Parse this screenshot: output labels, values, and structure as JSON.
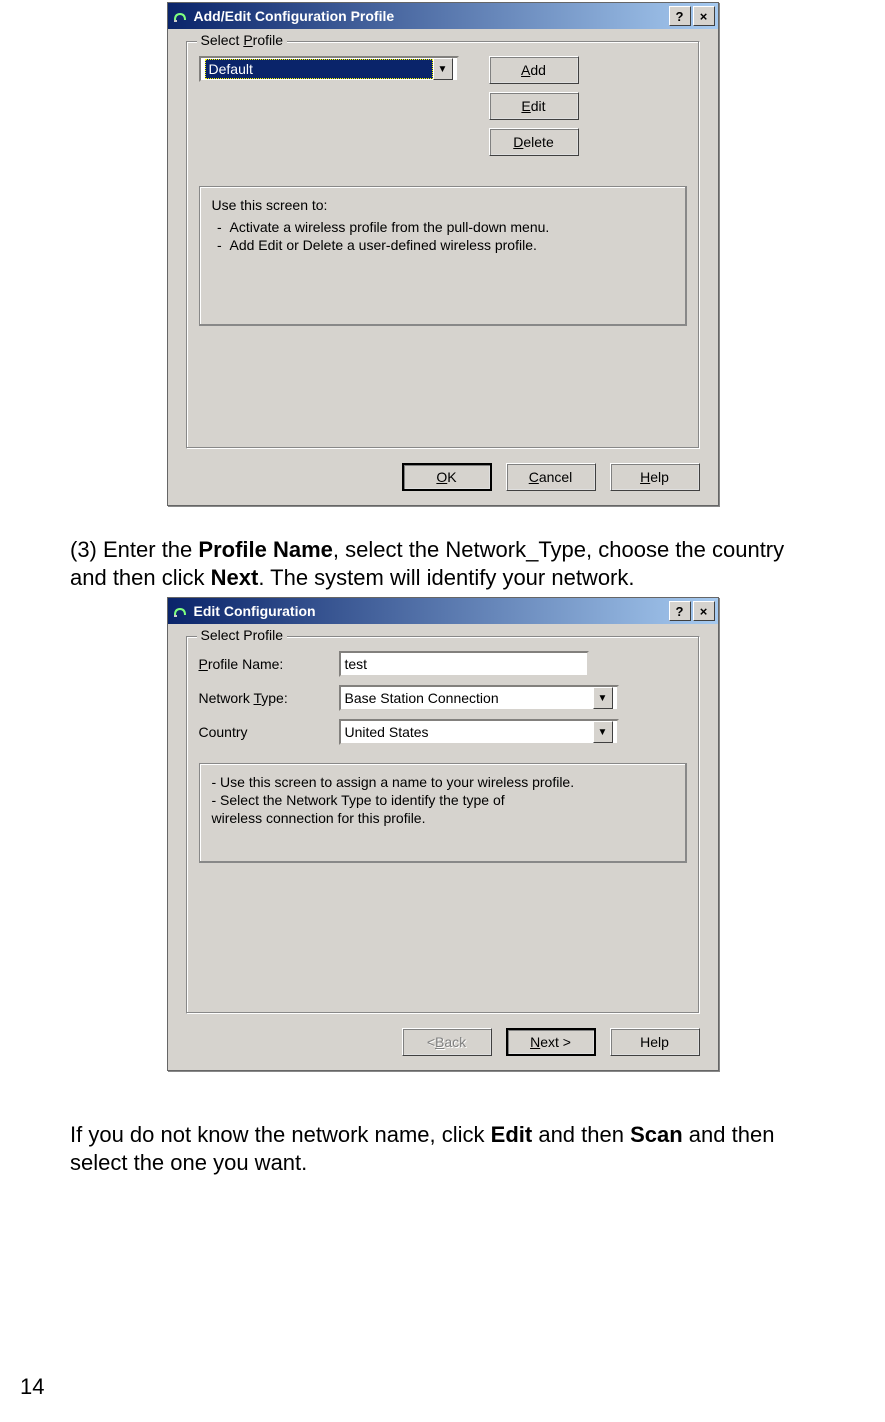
{
  "dialog1": {
    "title": "Add/Edit Configuration Profile",
    "help_btn": "?",
    "close_btn": "×",
    "group_legend_pre": "Select ",
    "group_legend_ul": "P",
    "group_legend_post": "rofile",
    "profile_selected": "Default",
    "add_ul": "A",
    "add_post": "dd",
    "edit_ul": "E",
    "edit_post": "dit",
    "delete_ul": "D",
    "delete_post": "elete",
    "info_title": "Use this screen to:",
    "info_item1": "Activate a wireless profile from the pull-down menu.",
    "info_item2": "Add Edit or Delete a user-defined wireless profile.",
    "ok_ul": "O",
    "ok_post": "K",
    "cancel_ul": "C",
    "cancel_post": "ancel",
    "help_ul2": "H",
    "help_post": "elp"
  },
  "doc_text1_a": "(3) Enter the ",
  "doc_text1_b": "Profile Name",
  "doc_text1_c": ", select the Network_Type, choose the country and then click ",
  "doc_text1_d": "Next",
  "doc_text1_e": ". The system will identify your network.",
  "dialog2": {
    "title": "Edit Configuration",
    "help_btn": "?",
    "close_btn": "×",
    "group_legend": "Select Profile",
    "lbl_profile_pre": "",
    "lbl_profile_ul": "P",
    "lbl_profile_post": "rofile Name:",
    "profile_value": "test",
    "lbl_nettype_pre": "Network ",
    "lbl_nettype_ul": "T",
    "lbl_nettype_post": "ype:",
    "nettype_value": "Base Station Connection",
    "lbl_country": "Country",
    "country_value": "United States",
    "info_line1": "-  Use this screen to assign a name to your wireless profile.",
    "info_line2": "-  Select the Network Type to identify the type of",
    "info_line3": "   wireless connection for this profile.",
    "back_pre": "< ",
    "back_ul": "B",
    "back_post": "ack",
    "next_ul": "N",
    "next_post": "ext >",
    "help": "Help"
  },
  "doc_text2_a": "If you do not know the network name, click ",
  "doc_text2_b": "Edit",
  "doc_text2_c": " and then ",
  "doc_text2_d": "Scan",
  "doc_text2_e": " and then select the one you want.",
  "page_number": "14"
}
